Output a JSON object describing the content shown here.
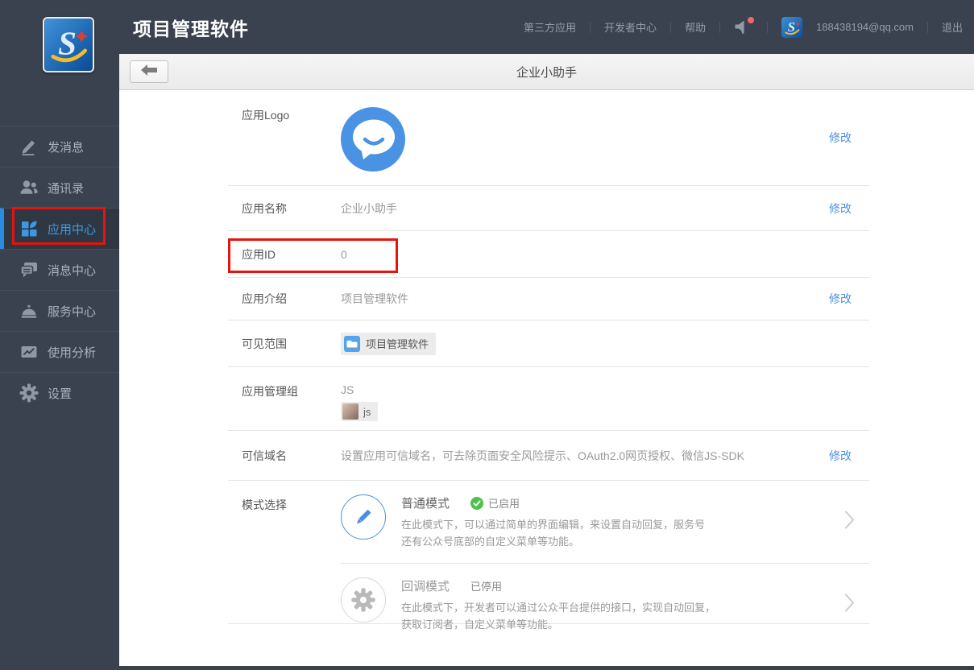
{
  "header": {
    "app_title": "项目管理软件",
    "nav_items": [
      {
        "label": "第三方应用"
      },
      {
        "label": "开发者中心"
      },
      {
        "label": "帮助"
      }
    ],
    "email": "188438194@qq.com",
    "logout_label": "退出"
  },
  "sidebar": {
    "items": [
      {
        "label": "发消息"
      },
      {
        "label": "通讯录"
      },
      {
        "label": "应用中心"
      },
      {
        "label": "消息中心"
      },
      {
        "label": "服务中心"
      },
      {
        "label": "使用分析"
      },
      {
        "label": "设置"
      }
    ],
    "active_item": "应用中心"
  },
  "toolbar": {
    "title": "企业小助手"
  },
  "app_detail": {
    "modify_label": "修改",
    "logo_row": {
      "label": "应用Logo"
    },
    "name_row": {
      "label": "应用名称",
      "value": "企业小助手"
    },
    "id_row": {
      "label": "应用ID",
      "value": "0"
    },
    "intro_row": {
      "label": "应用介绍",
      "value": "项目管理软件"
    },
    "scope_row": {
      "label": "可见范围",
      "tag": "项目管理软件"
    },
    "group_row": {
      "label": "应用管理组",
      "group_name": "JS",
      "member_name": "js"
    },
    "domain_row": {
      "label": "可信域名",
      "value": "设置应用可信域名，可去除页面安全风险提示、OAuth2.0网页授权、微信JS-SDK"
    },
    "mode_row": {
      "label": "模式选择",
      "modes": [
        {
          "name": "普通模式",
          "status": "已启用",
          "enabled": true,
          "desc1": "在此模式下，可以通过简单的界面编辑，来设置自动回复，服务号",
          "desc2": "还有公众号底部的自定义菜单等功能。"
        },
        {
          "name": "回调模式",
          "status": "已停用",
          "enabled": false,
          "desc1": "在此模式下，开发者可以通过公众平台提供的接口，实现自动回复，",
          "desc2": "获取订阅者，自定义菜单等功能。"
        }
      ]
    }
  },
  "colors": {
    "accent_blue": "#4a90e2",
    "annotation_red": "#e8120e",
    "enabled_green": "#4cc14c",
    "sidebar_bg": "#39424e",
    "active_item_blue": "#2a8ce0"
  }
}
